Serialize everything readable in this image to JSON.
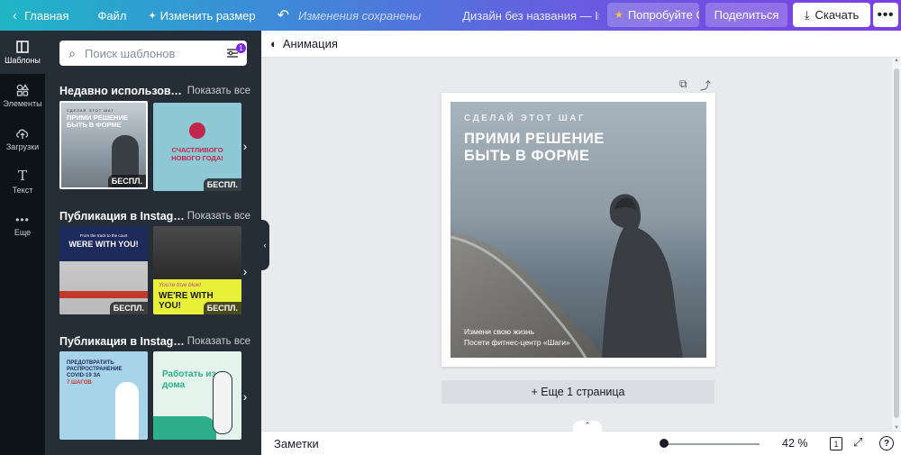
{
  "topbar": {
    "home": "Главная",
    "file": "Файл",
    "resize": "Изменить размер",
    "saved_status": "Изменения сохранены",
    "design_title": "Дизайн без названия — Instagram",
    "try_label": "Попробуйте Canva Pro",
    "share_label": "Поделиться",
    "download_label": "Скачать",
    "more_label": "•••"
  },
  "rail": {
    "items": [
      {
        "label": "Шаблоны",
        "icon": "templates-icon"
      },
      {
        "label": "Элементы",
        "icon": "elements-icon"
      },
      {
        "label": "Загрузки",
        "icon": "uploads-icon"
      },
      {
        "label": "Текст",
        "icon": "text-icon"
      },
      {
        "label": "Еще",
        "icon": "more-icon"
      }
    ]
  },
  "panel": {
    "search_placeholder": "Поиск шаблонов",
    "filter_badge": "1",
    "sections": [
      {
        "title": "Недавно использованные",
        "show_all": "Показать все",
        "thumbs": [
          {
            "free": "БЕСПЛ.",
            "line1": "СДЕЛАЙ ЭТОТ ШАГ",
            "line2": "ПРИМИ РЕШЕНИЕ БЫТЬ В ФОРМЕ"
          },
          {
            "free": "БЕСПЛ.",
            "line1": "СЧАСТЛИВОГО НОВОГО ГОДА!"
          }
        ]
      },
      {
        "title": "Публикация в Instagram",
        "show_all": "Показать все",
        "thumbs": [
          {
            "free": "БЕСПЛ.",
            "line1": "From the track to the court",
            "line2": "WERE WITH YOU!"
          },
          {
            "free": "БЕСПЛ.",
            "line1": "You're true blue!",
            "line2": "WE'RE WITH YOU!"
          }
        ]
      },
      {
        "title": "Публикация в Instagram",
        "show_all": "Показать все",
        "thumbs": [
          {
            "line1": "ПРЕДОТВРАТИТЬ РАСПРОСТРАНЕНИЕ COVID-19 ЗА",
            "line2": "7 ШАГОВ"
          },
          {
            "line1": "Работать из дома"
          }
        ]
      }
    ]
  },
  "toolbar": {
    "animation": "Анимация"
  },
  "design": {
    "small_heading": "СДЕЛАЙ ЭТОТ ШАГ",
    "big_heading_1": "ПРИМИ РЕШЕНИЕ",
    "big_heading_2": "БЫТЬ В ФОРМЕ",
    "footer_1": "Измени свою жизнь",
    "footer_2": "Посети фитнес-центр «Шаги»"
  },
  "canvas": {
    "add_page": "+ Еще 1 страница"
  },
  "bottombar": {
    "notes": "Заметки",
    "zoom_value": "42 %",
    "zoom_fraction": 0.02,
    "page_count": "1"
  },
  "colors": {
    "accent": "#7d2ae8",
    "panel_bg": "#252d36",
    "rail_bg": "#0e1318"
  }
}
